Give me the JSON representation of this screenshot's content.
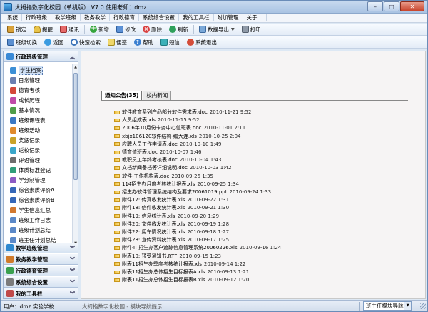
{
  "window": {
    "title": "大拇指数字化校园（单机版） V7.0 使用老师：dmz",
    "minimize": "–",
    "maximize": "□",
    "close": "✕"
  },
  "menu": [
    "系统",
    "行政班级",
    "教学班级",
    "教务教学",
    "行政德育",
    "系统综合设置",
    "我的工具栏",
    "附加管理",
    "关于..."
  ],
  "toolbar1": {
    "lock": "锁定",
    "remind": "提醒",
    "contacts": "通讯",
    "add": "新增",
    "modify": "修改",
    "delete": "删除",
    "refresh": "刷新",
    "export": "数据导出",
    "print": "打印"
  },
  "toolbar2": {
    "switch_class": "班级切换",
    "back": "返回",
    "quick_search": "快速检索",
    "note": "便签",
    "help": "帮助",
    "sms": "短信",
    "exit": "系统退出"
  },
  "sidebar": {
    "section_active": "行政班级管理",
    "items": [
      {
        "label": "学生档案",
        "color": "#3c8fd6"
      },
      {
        "label": "日常管理",
        "color": "#6b7fb0"
      },
      {
        "label": "德育考核",
        "color": "#d4483a"
      },
      {
        "label": "成长历程",
        "color": "#c04aa8"
      },
      {
        "label": "基本情况",
        "color": "#4f9d4a"
      },
      {
        "label": "班级课程表",
        "color": "#3a78c4"
      },
      {
        "label": "班级活动",
        "color": "#e08a2c"
      },
      {
        "label": "奖惩记录",
        "color": "#c9a227"
      },
      {
        "label": "返校记录",
        "color": "#3aa6c9"
      },
      {
        "label": "评语管理",
        "color": "#6d6d6d"
      },
      {
        "label": "体质标准登记",
        "color": "#2f9e7a"
      },
      {
        "label": "学分制管理",
        "color": "#8c5bc4"
      },
      {
        "label": "综合素质评价A",
        "color": "#3567b8"
      },
      {
        "label": "综合素质评价B",
        "color": "#3567b8"
      },
      {
        "label": "学生信息汇总",
        "color": "#d2782f"
      },
      {
        "label": "班级工作日志",
        "color": "#5a88c8"
      },
      {
        "label": "班级计划总结",
        "color": "#5a88c8"
      },
      {
        "label": "班主任计划总结",
        "color": "#5a88c8"
      }
    ],
    "sections_bottom": [
      {
        "label": "教学班级管理",
        "color": "#2e88cf"
      },
      {
        "label": "教务教学管理",
        "color": "#d07a2a"
      },
      {
        "label": "行政德育管理",
        "color": "#3aa04f"
      },
      {
        "label": "系统综合设置",
        "color": "#7b7b7b"
      },
      {
        "label": "我的工具栏",
        "color": "#c04a4a"
      }
    ]
  },
  "tabs": {
    "notices": "通知公告(35)",
    "school_news": "校内新闻"
  },
  "documents": [
    {
      "name": "软件教育系列产品部分软件需求表.doc",
      "date": "2010-11-21 9:52"
    },
    {
      "name": "人员组成表.xls",
      "date": "2010-11-15 9:52"
    },
    {
      "name": "2006年10月份卡务中心值班表.doc",
      "date": "2010-11-01 2:11"
    },
    {
      "name": "xbjx106120软件结构-编大连.xls",
      "date": "2010-10-25 2:04"
    },
    {
      "name": "应聘人员工作申请表.doc",
      "date": "2010-10-10 1:49"
    },
    {
      "name": "德育值班表.doc",
      "date": "2010-10-07 1:46"
    },
    {
      "name": "教职员工年终考核表.doc",
      "date": "2010-10-04 1:43"
    },
    {
      "name": "文档新闻备档等详细说明.doc",
      "date": "2010-10-03 1:42"
    },
    {
      "name": "软件-工作机构表.doc",
      "date": "2010-09-26 1:35"
    },
    {
      "name": "114招生办月度考核统计报表.xls",
      "date": "2010-09-25 1:34"
    },
    {
      "name": "招生办软件管理系统结构及要求20061019.ppt",
      "date": "2010-09-24 1:33"
    },
    {
      "name": "附件17: 传真收发统计表.xls",
      "date": "2010-09-22 1:31"
    },
    {
      "name": "附件18: 信件收发统计表.xls",
      "date": "2010-09-21 1:30"
    },
    {
      "name": "附件19: 信息统计表.xls",
      "date": "2010-09-20 1:29"
    },
    {
      "name": "附件20: 文件收发统计表.xls",
      "date": "2010-09-19 1:28"
    },
    {
      "name": "附件22: 用车情况统计表.xls",
      "date": "2010-09-18 1:27"
    },
    {
      "name": "附件28: 宣传资料统计表.xls",
      "date": "2010-09-17 1:25"
    },
    {
      "name": "附件4: 招生办客户追踪信息管理系统20060226.xls",
      "date": "2010-09-16 1:24"
    },
    {
      "name": "附表10: 预受通知书.RTF",
      "date": "2010-09-15 1:23"
    },
    {
      "name": "附表11招生办季度考核统计报表.xls",
      "date": "2010-09-14 1:22"
    },
    {
      "name": "附表11招生办总体招生目标报表A.xls",
      "date": "2010-09-13 1:21"
    },
    {
      "name": "附表11招生办总体招生目标报表B.xls",
      "date": "2010-09-12 1:20"
    }
  ],
  "status": {
    "user": "用户：dmz 实验学校",
    "message": "大拇指数字化校园 - 模块导航提示",
    "nav_select": "班主任模块导航"
  }
}
